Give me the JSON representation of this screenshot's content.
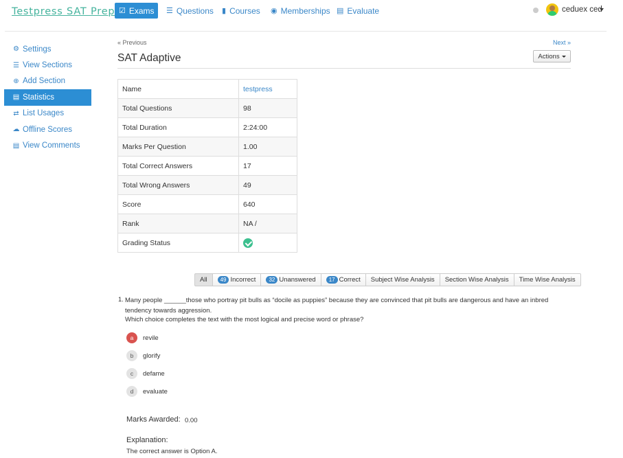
{
  "brand": "Testpress SAT Prep",
  "nav": {
    "exams": "Exams",
    "questions": "Questions",
    "courses": "Courses",
    "memberships": "Memberships",
    "evaluate": "Evaluate"
  },
  "user": {
    "name": "ceduex ced"
  },
  "sidebar": {
    "items": [
      {
        "label": "Settings",
        "icon": "gear-icon"
      },
      {
        "label": "View Sections",
        "icon": "list-icon"
      },
      {
        "label": "Add Section",
        "icon": "plus-circle-icon"
      },
      {
        "label": "Statistics",
        "icon": "bar-chart-icon"
      },
      {
        "label": "List Usages",
        "icon": "exchange-icon"
      },
      {
        "label": "Offline Scores",
        "icon": "cloud-upload-icon"
      },
      {
        "label": "View Comments",
        "icon": "comment-icon"
      }
    ],
    "active": "Statistics"
  },
  "pager": {
    "previous": "« Previous",
    "next": "Next »"
  },
  "page": {
    "title": "SAT Adaptive",
    "actions_label": "Actions"
  },
  "stats": {
    "name_label": "Name",
    "name_value": "testpress",
    "total_questions_label": "Total Questions",
    "total_questions_value": "98",
    "total_duration_label": "Total Duration",
    "total_duration_value": "2:24:00",
    "marks_per_question_label": "Marks Per Question",
    "marks_per_question_value": "1.00",
    "total_correct_label": "Total Correct Answers",
    "total_correct_value": "17",
    "total_wrong_label": "Total Wrong Answers",
    "total_wrong_value": "49",
    "score_label": "Score",
    "score_value": "640",
    "rank_label": "Rank",
    "rank_value": "NA /",
    "grading_status_label": "Grading Status"
  },
  "filters": {
    "all": "All",
    "incorrect_count": "49",
    "incorrect": "Incorrect",
    "unanswered_count": "32",
    "unanswered": "Unanswered",
    "correct_count": "17",
    "correct": "Correct",
    "subject_wise": "Subject Wise Analysis",
    "section_wise": "Section Wise Analysis",
    "time_wise": "Time Wise Analysis",
    "active": "All"
  },
  "question": {
    "number": "1.",
    "text": "Many people ______those who portray pit bulls as “docile as puppies” because they are convinced that pit bulls are dangerous and have an inbred tendency towards aggression.",
    "prompt": "Which choice completes the text with the most logical and precise word or phrase?",
    "options": [
      {
        "key": "a",
        "text": "revile",
        "state": "wrong"
      },
      {
        "key": "b",
        "text": "glorify",
        "state": "neutral"
      },
      {
        "key": "c",
        "text": "defame",
        "state": "neutral"
      },
      {
        "key": "d",
        "text": "evaluate",
        "state": "neutral"
      }
    ],
    "marks_label": "Marks Awarded:",
    "marks_value": "0.00",
    "explanation_label": "Explanation:",
    "explanation_text": "The correct answer is Option A."
  },
  "colors": {
    "accent": "#2c8ed4",
    "link": "#3a87c8",
    "brand": "#45b39d",
    "wrong": "#d9534f",
    "success": "#3cc08f"
  }
}
